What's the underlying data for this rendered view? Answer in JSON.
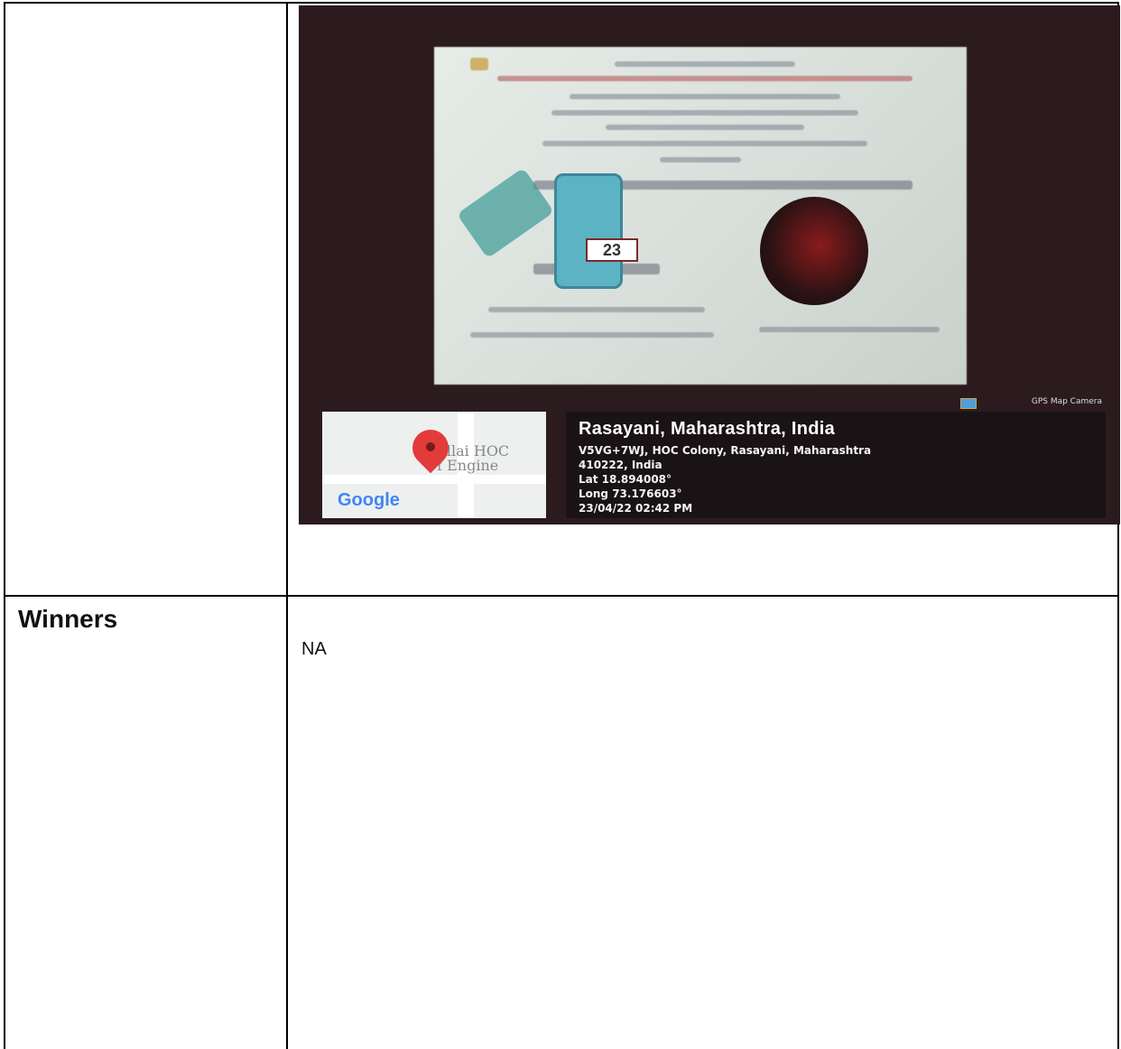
{
  "table": {
    "rows": [
      {
        "label": "",
        "value": ""
      },
      {
        "label": "Winners",
        "value": "NA"
      }
    ]
  },
  "photo": {
    "poster_date": "23",
    "gps_badge": "GPS Map Camera",
    "map": {
      "place_label_line1": "Pillai HOC",
      "place_label_line2": "Of Engine",
      "google_logo": "Google"
    },
    "location": {
      "title": "Rasayani, Maharashtra, India",
      "address_line1": "V5VG+7WJ, HOC Colony, Rasayani, Maharashtra",
      "address_line2": "410222, India",
      "lat": "Lat 18.894008°",
      "long": "Long 73.176603°",
      "timestamp": "23/04/22 02:42 PM"
    },
    "colors": {
      "pin": "#e33b3b",
      "info_card_bg": "#1a1315",
      "phone": "#5bb3c4"
    }
  }
}
